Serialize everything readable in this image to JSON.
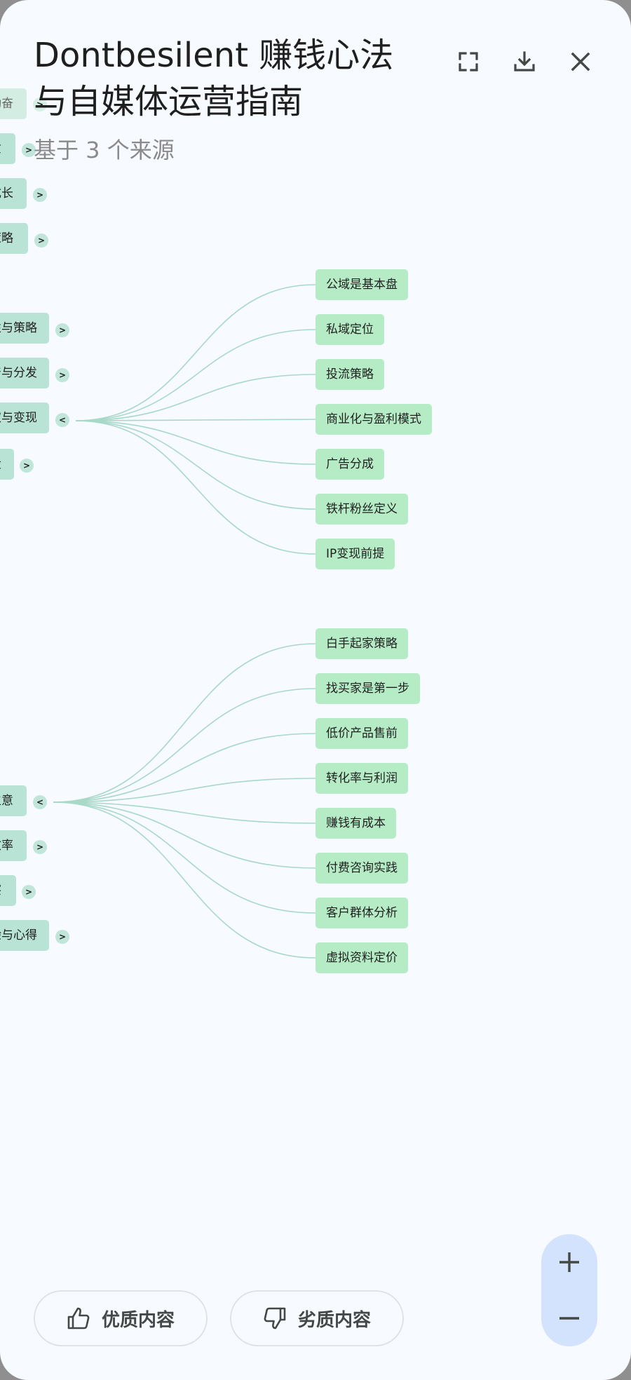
{
  "header": {
    "title_line1": "Dontbesilent 赚钱心法",
    "title_line2": "与自媒体运营指南",
    "subtitle": "基于 3 个来源",
    "icons": {
      "fullscreen": "fullscreen-icon",
      "download": "download-icon",
      "close": "close-icon"
    }
  },
  "mindmap": {
    "left_nodes": [
      {
        "label": "动奋",
        "toggle": ">",
        "faded": true
      },
      {
        "label": "质",
        "toggle": ">"
      },
      {
        "label": "成长",
        "toggle": ">"
      },
      {
        "label": "策略",
        "toggle": ">"
      },
      {
        "label": "性与策略",
        "toggle": ">"
      },
      {
        "label": "产与分发",
        "toggle": ">"
      },
      {
        "label": "取与变现",
        "toggle": "<"
      },
      {
        "label": "设",
        "toggle": ">"
      },
      {
        "label": "生意",
        "toggle": "<"
      },
      {
        "label": "效率",
        "toggle": ">"
      },
      {
        "label": "察",
        "toggle": ">"
      },
      {
        "label": "验与心得",
        "toggle": ">"
      }
    ],
    "group1_leaves": [
      "公域是基本盘",
      "私域定位",
      "投流策略",
      "商业化与盈利模式",
      "广告分成",
      "铁杆粉丝定义",
      "IP变现前提"
    ],
    "group2_leaves": [
      "白手起家策略",
      "找买家是第一步",
      "低价产品售前",
      "转化率与利润",
      "赚钱有成本",
      "付费咨询实践",
      "客户群体分析",
      "虚拟资料定价"
    ],
    "colors": {
      "parent": "#b8e3d5",
      "leaf": "#b5ecc5",
      "link": "#a8d8c8"
    }
  },
  "zoom": {
    "in_icon": "plus-icon",
    "out_icon": "minus-icon"
  },
  "feedback": {
    "good_label": "优质内容",
    "bad_label": "劣质内容",
    "good_icon": "thumbs-up-icon",
    "bad_icon": "thumbs-down-icon"
  }
}
